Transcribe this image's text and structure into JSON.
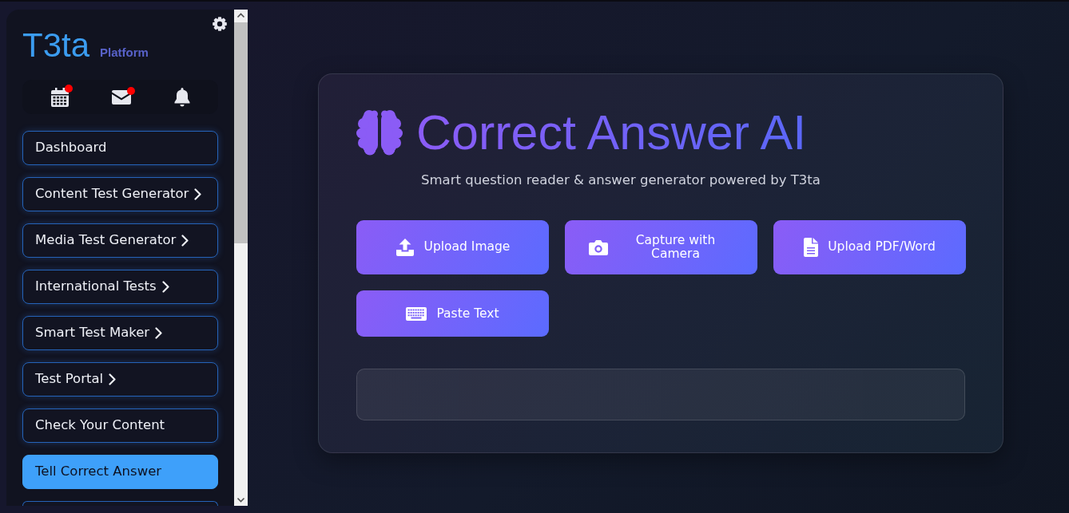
{
  "sidebar": {
    "logo": {
      "name": "T3ta",
      "tagline": "Platform"
    },
    "quick_icons": [
      {
        "kind": "calendar",
        "badge": true
      },
      {
        "kind": "mail",
        "badge": true
      },
      {
        "kind": "bell",
        "badge": false
      }
    ],
    "items": [
      {
        "kind": "link",
        "label": "Dashboard",
        "submenu": false,
        "selected": false
      },
      {
        "kind": "link",
        "label": "Content Test Generator",
        "submenu": true,
        "selected": false
      },
      {
        "kind": "link",
        "label": "Media Test Generator",
        "submenu": true,
        "selected": false
      },
      {
        "kind": "link",
        "label": "International Tests",
        "submenu": true,
        "selected": false
      },
      {
        "kind": "link",
        "label": "Smart Test Maker",
        "submenu": true,
        "selected": false
      },
      {
        "kind": "link",
        "label": "Test Portal",
        "submenu": true,
        "selected": false
      },
      {
        "kind": "link",
        "label": "Check Your Content",
        "submenu": false,
        "selected": false
      },
      {
        "kind": "link",
        "label": "Tell Correct Answer",
        "submenu": false,
        "selected": true
      },
      {
        "kind": "clipped",
        "selected": false
      }
    ]
  },
  "main": {
    "title": "Correct Answer AI",
    "subtitle": "Smart question reader & answer generator powered by T3ta",
    "actions": [
      {
        "kind": "upload",
        "label": "Upload Image"
      },
      {
        "kind": "camera",
        "label": "Capture with Camera"
      },
      {
        "kind": "file",
        "label": "Upload PDF/Word"
      },
      {
        "kind": "keyboard",
        "label": "Paste Text"
      }
    ]
  }
}
